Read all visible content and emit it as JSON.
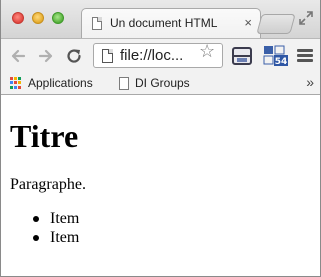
{
  "tab": {
    "title": "Un document HTML",
    "close_glyph": "×"
  },
  "omnibox": {
    "url": "file://loc..."
  },
  "bookmarks": {
    "items": [
      {
        "label": "Applications",
        "icon": "apps-grid-icon"
      },
      {
        "label": "DI Groups",
        "icon": "page-icon"
      }
    ],
    "more_glyph": "»"
  },
  "page": {
    "heading": "Titre",
    "paragraph": "Paragraphe.",
    "list": [
      "Item",
      "Item"
    ]
  },
  "colors": {
    "close": "#e0443e",
    "minimize": "#e3a92a",
    "maximize": "#53ad38"
  },
  "icons": [
    "back-arrow-icon",
    "forward-arrow-icon",
    "reload-icon",
    "star-icon",
    "menu-icon",
    "fullscreen-icon",
    "extension-icon"
  ]
}
